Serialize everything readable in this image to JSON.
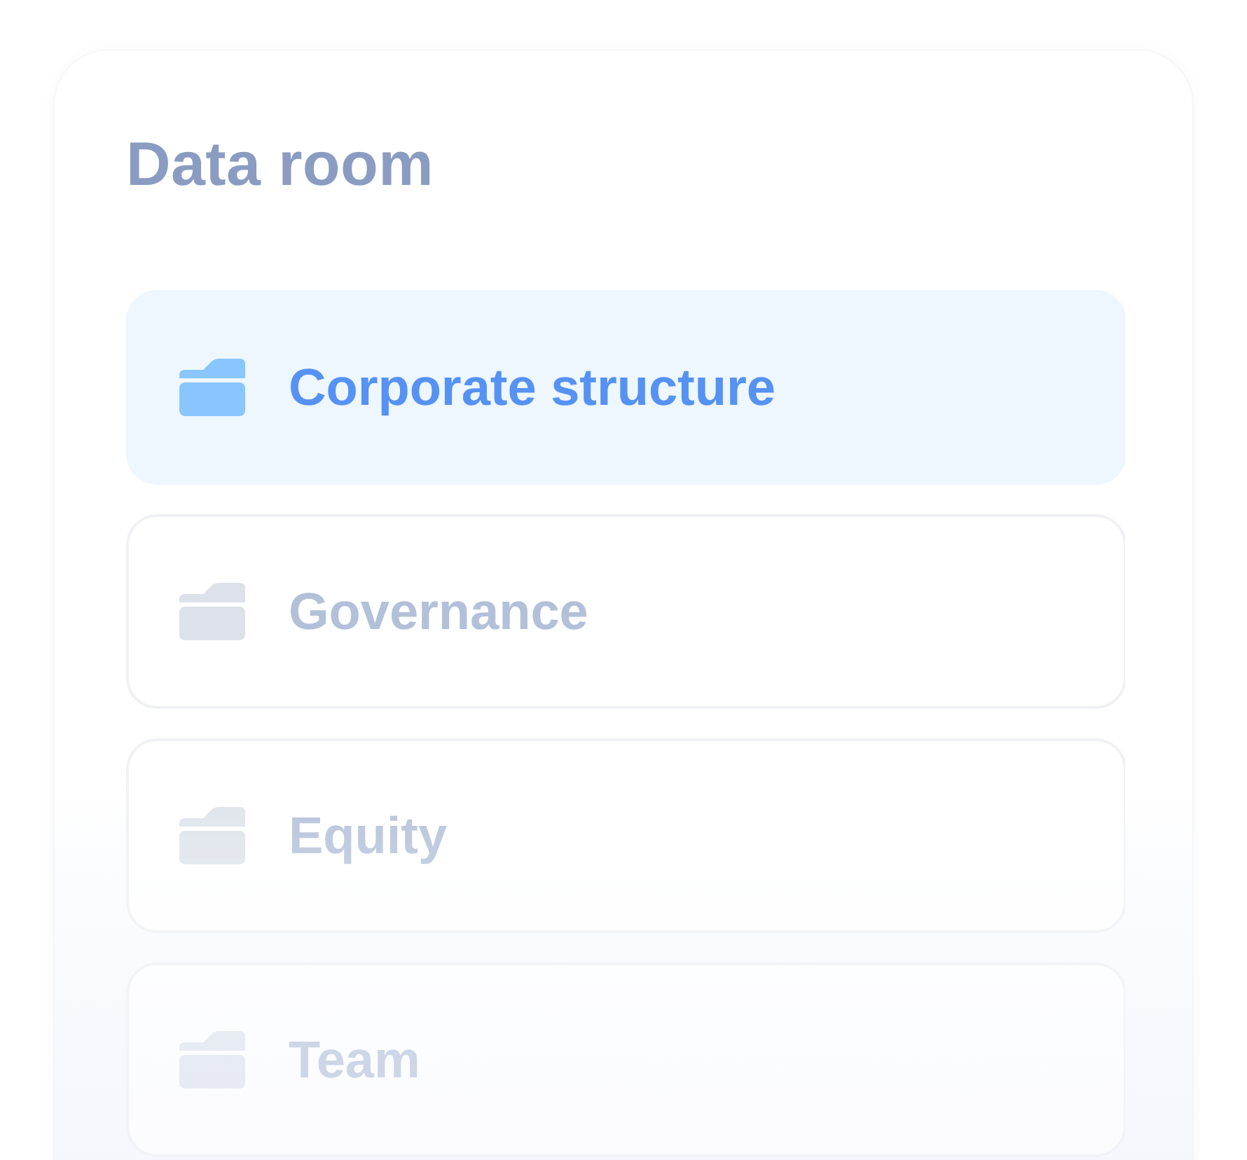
{
  "title": "Data room",
  "folders": [
    {
      "name": "Corporate structure",
      "selected": true
    },
    {
      "name": "Governance",
      "selected": false
    },
    {
      "name": "Equity",
      "selected": false
    },
    {
      "name": "Team",
      "selected": false
    }
  ]
}
